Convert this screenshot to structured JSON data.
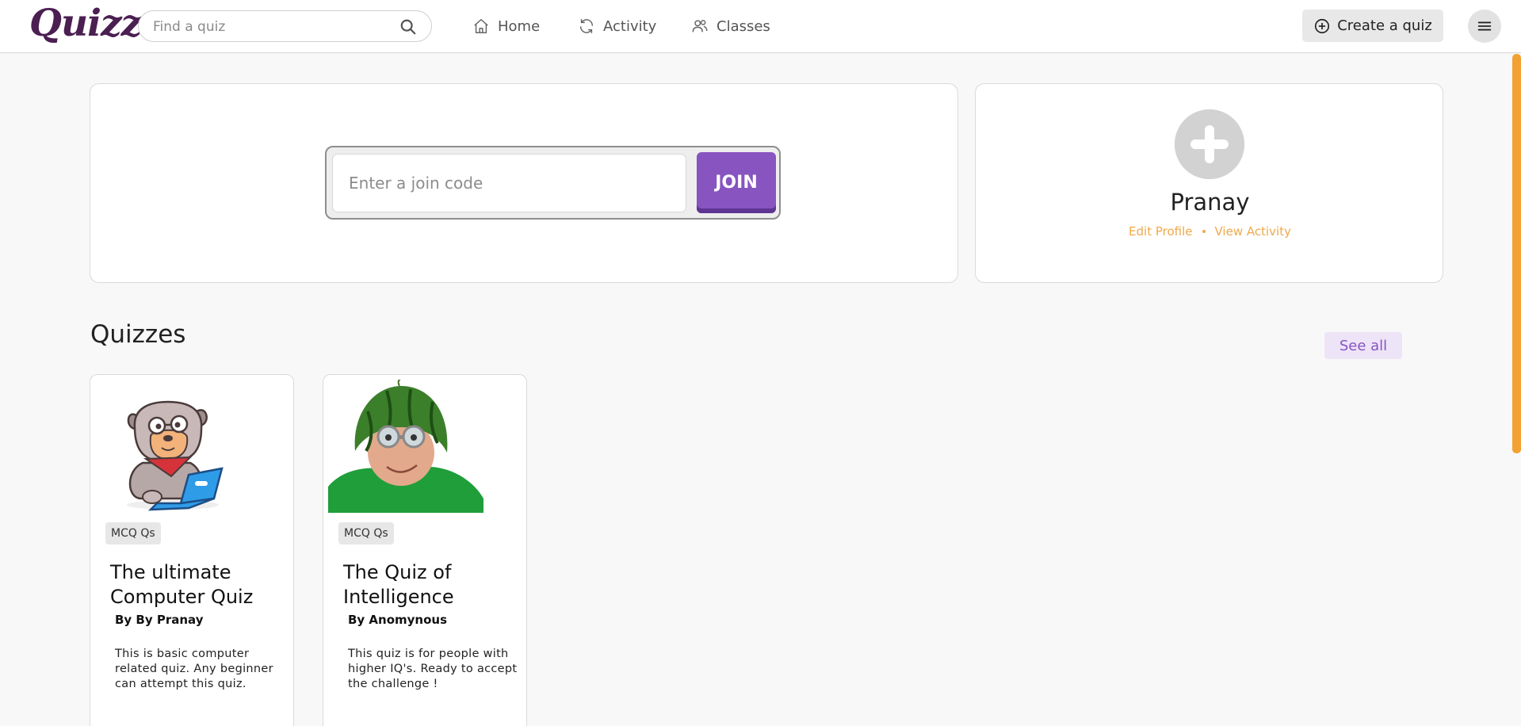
{
  "app": {
    "logo": "Quizz"
  },
  "search": {
    "placeholder": "Find a quiz"
  },
  "nav": {
    "home": "Home",
    "activity": "Activity",
    "classes": "Classes"
  },
  "actions": {
    "create": "Create a quiz"
  },
  "join": {
    "placeholder": "Enter a join code",
    "button": "JOIN"
  },
  "profile": {
    "name": "Pranay",
    "edit": "Edit Profile",
    "view_activity": "View Activity"
  },
  "quizzes": {
    "title": "Quizzes",
    "see_all": "See all",
    "items": [
      {
        "tag": "MCQ Qs",
        "title": "The ultimate Computer Quiz",
        "author": "By By Pranay",
        "description": "This is basic computer related quiz. Any beginner can attempt this quiz.",
        "image": "cartoon-bulldog-with-laptop"
      },
      {
        "tag": "MCQ Qs",
        "title": "The Quiz of Intelligence",
        "author": "By Anomynous",
        "description": "This quiz is for people with higher IQ's. Ready to accept the challenge !",
        "image": "man-wearing-watermelon-helmet"
      }
    ]
  },
  "colors": {
    "brand": "#4b1f52",
    "accent": "#8854c0",
    "orange": "#f0a94a"
  }
}
